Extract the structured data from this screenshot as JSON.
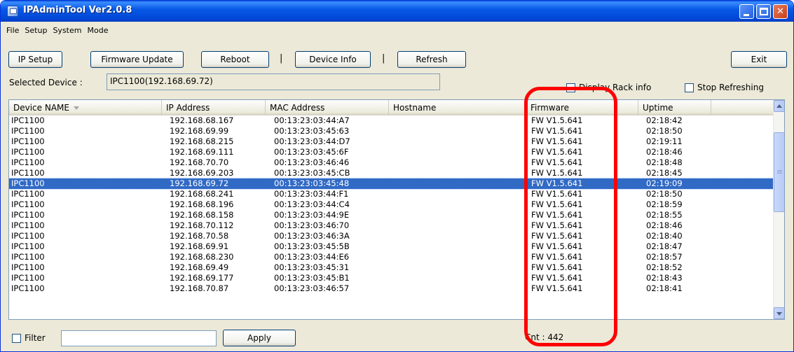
{
  "window": {
    "title": "IPAdminTool Ver2.0.8"
  },
  "menu": [
    "File",
    "Setup",
    "System",
    "Mode"
  ],
  "toolbar": {
    "ip_setup": "IP Setup",
    "firmware_update": "Firmware Update",
    "reboot": "Reboot",
    "separator": "|",
    "device_info": "Device Info",
    "refresh": "Refresh",
    "exit": "Exit"
  },
  "selected_device": {
    "label": "Selected Device :",
    "value": "IPC1100(192.168.69.72)"
  },
  "options": {
    "display_rack_info": {
      "label": "Display Rack info",
      "checked": false
    },
    "stop_refreshing": {
      "label": "Stop Refreshing",
      "checked": false
    }
  },
  "table": {
    "columns": [
      "Device NAME",
      "IP Address",
      "MAC Address",
      "Hostname",
      "Firmware",
      "Uptime"
    ],
    "selected_index": 6,
    "rows": [
      [
        "IPC1100",
        "192.168.68.167",
        "00:13:23:03:44:A7",
        "",
        "FW V1.5.641",
        "02:18:42"
      ],
      [
        "IPC1100",
        "192.168.69.99",
        "00:13:23:03:45:63",
        "",
        "FW V1.5.641",
        "02:18:50"
      ],
      [
        "IPC1100",
        "192.168.68.215",
        "00:13:23:03:44:D7",
        "",
        "FW V1.5.641",
        "02:19:11"
      ],
      [
        "IPC1100",
        "192.168.69.111",
        "00:13:23:03:45:6F",
        "",
        "FW V1.5.641",
        "02:18:46"
      ],
      [
        "IPC1100",
        "192.168.70.70",
        "00:13:23:03:46:46",
        "",
        "FW V1.5.641",
        "02:18:48"
      ],
      [
        "IPC1100",
        "192.168.69.203",
        "00:13:23:03:45:CB",
        "",
        "FW V1.5.641",
        "02:18:45"
      ],
      [
        "IPC1100",
        "192.168.69.72",
        "00:13:23:03:45:48",
        "",
        "FW V1.5.641",
        "02:19:09"
      ],
      [
        "IPC1100",
        "192.168.68.241",
        "00:13:23:03:44:F1",
        "",
        "FW V1.5.641",
        "02:18:50"
      ],
      [
        "IPC1100",
        "192.168.68.196",
        "00:13:23:03:44:C4",
        "",
        "FW V1.5.641",
        "02:18:59"
      ],
      [
        "IPC1100",
        "192.168.68.158",
        "00:13:23:03:44:9E",
        "",
        "FW V1.5.641",
        "02:18:55"
      ],
      [
        "IPC1100",
        "192.168.70.112",
        "00:13:23:03:46:70",
        "",
        "FW V1.5.641",
        "02:18:46"
      ],
      [
        "IPC1100",
        "192.168.70.58",
        "00:13:23:03:46:3A",
        "",
        "FW V1.5.641",
        "02:18:40"
      ],
      [
        "IPC1100",
        "192.168.69.91",
        "00:13:23:03:45:5B",
        "",
        "FW V1.5.641",
        "02:18:47"
      ],
      [
        "IPC1100",
        "192.168.68.230",
        "00:13:23:03:44:E6",
        "",
        "FW V1.5.641",
        "02:18:57"
      ],
      [
        "IPC1100",
        "192.168.69.49",
        "00:13:23:03:45:31",
        "",
        "FW V1.5.641",
        "02:18:52"
      ],
      [
        "IPC1100",
        "192.168.69.177",
        "00:13:23:03:45:B1",
        "",
        "FW V1.5.641",
        "02:18:43"
      ],
      [
        "IPC1100",
        "192.168.70.87",
        "00:13:23:03:46:57",
        "",
        "FW V1.5.641",
        "02:18:41"
      ]
    ]
  },
  "bottom": {
    "filter_label": "Filter",
    "filter_checked": false,
    "filter_value": "",
    "apply": "Apply",
    "count": "Cnt : 442"
  },
  "colors": {
    "titlebar": "#0046d5",
    "selection": "#316ac5",
    "annotation": "#ff0000"
  },
  "icons": {
    "app": "app-icon",
    "minimize": "minimize-icon",
    "maximize": "maximize-icon",
    "close": "close-icon",
    "sort": "sort-down-icon",
    "scroll_up": "scroll-up-arrow-icon",
    "scroll_down": "scroll-down-arrow-icon"
  }
}
